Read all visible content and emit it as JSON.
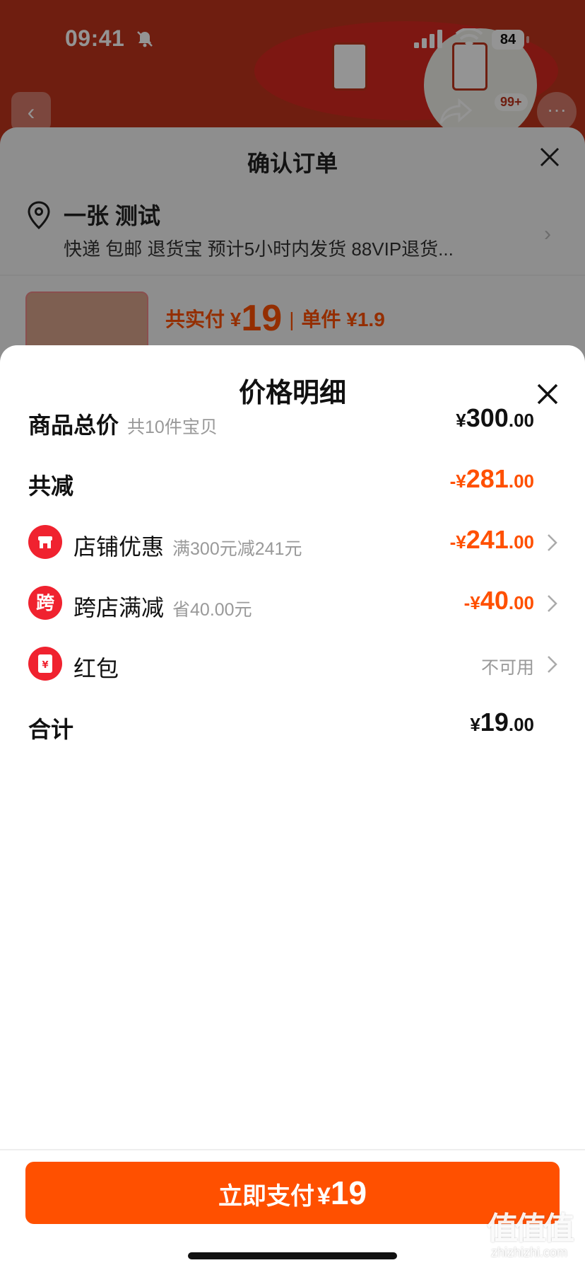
{
  "status_bar": {
    "time": "09:41",
    "battery": "84"
  },
  "background_nav": {
    "cart_badge": "99+"
  },
  "order": {
    "title": "确认订单",
    "address_name": "一张 测试",
    "address_detail": "快递 包邮 退货宝 预计5小时内发货 88VIP退货...",
    "paid_label": "共实付 ¥",
    "paid_amount": "19",
    "unit_label": "单件 ¥1.9"
  },
  "price_detail": {
    "title": "价格明细",
    "rows": [
      {
        "label": "商品总价",
        "sub": "共10件宝贝",
        "currency": "¥",
        "integer": "300",
        "decimal": ".00"
      },
      {
        "label": "共减",
        "sub": "",
        "currency": "-¥",
        "integer": "281",
        "decimal": ".00"
      },
      {
        "icon_text": "",
        "label": "店铺优惠",
        "sub": "满300元减241元",
        "currency": "-¥",
        "integer": "241",
        "decimal": ".00"
      },
      {
        "icon_text": "跨",
        "label": "跨店满减",
        "sub": "省40.00元",
        "currency": "-¥",
        "integer": "40",
        "decimal": ".00"
      },
      {
        "icon_text": "¥",
        "label": "红包",
        "sub": "",
        "status": "不可用"
      },
      {
        "label": "合计",
        "sub": "",
        "currency": "¥",
        "integer": "19",
        "decimal": ".00"
      }
    ]
  },
  "pay_button": {
    "label": "立即支付",
    "currency": "¥",
    "amount": "19"
  },
  "watermark": {
    "text": "zhizhizhi.com",
    "mark": "值值值"
  },
  "colors": {
    "accent": "#ff5000",
    "icon_red": "#f0222f",
    "muted": "#999999"
  }
}
